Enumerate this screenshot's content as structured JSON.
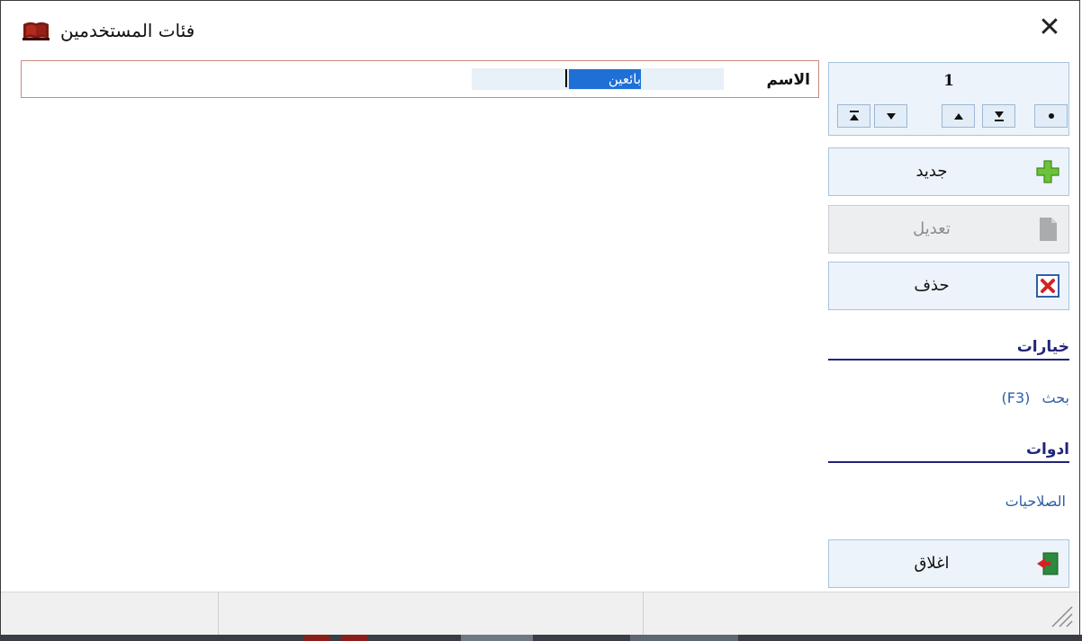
{
  "window": {
    "title": "فئات المستخدمين",
    "close_symbol": "✕",
    "icon": "app-book-icon"
  },
  "form": {
    "name_label": "الاسم",
    "name_value": "بائعين"
  },
  "navigator": {
    "record_number": "1",
    "buttons": [
      {
        "symbol": "●",
        "name": "nav-insert-button",
        "icon": "dot-icon"
      },
      {
        "symbol": "⯓",
        "name": "nav-last-button",
        "icon": "last-icon"
      },
      {
        "symbol": "▲",
        "name": "nav-prev-button",
        "icon": "up-icon"
      },
      {
        "symbol": "▼",
        "name": "nav-next-button",
        "icon": "down-icon"
      },
      {
        "symbol": "⯒",
        "name": "nav-first-button",
        "icon": "first-icon"
      }
    ]
  },
  "actions": {
    "new_label": "جديد",
    "edit_label": "تعديل",
    "delete_label": "حذف",
    "close_label": "اغلاق"
  },
  "options": {
    "heading": "خيارات",
    "search_label": "بحث",
    "search_shortcut": "(F3)"
  },
  "tools": {
    "heading": "ادوات",
    "permissions_label": "الصلاحيات"
  },
  "colors": {
    "accent": "#21247a",
    "link": "#2f5fa8",
    "selection": "#1e6fd6",
    "panel": "#edf3fa"
  }
}
